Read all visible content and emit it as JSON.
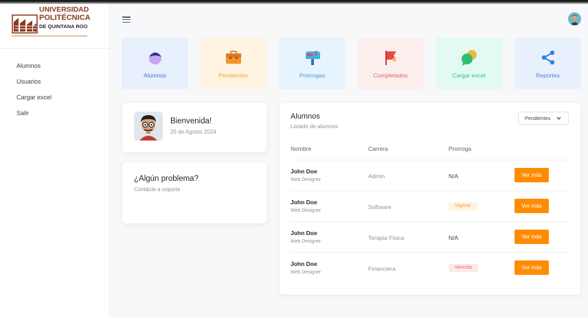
{
  "logo": {
    "line1": "UNIVERSIDAD",
    "line2": "POLITÉCNICA",
    "line3": "DE QUINTANA ROO"
  },
  "sidebar": {
    "items": [
      {
        "label": "Alumnos"
      },
      {
        "label": "Usuarios"
      },
      {
        "label": "Cargar excel"
      },
      {
        "label": "Salir"
      }
    ]
  },
  "cards": [
    {
      "label": "Alumnos",
      "bg": "#e8effd",
      "color": "#4a73d9",
      "icon": "student-icon"
    },
    {
      "label": "Pendientes",
      "bg": "#fff4e2",
      "color": "#f0a030",
      "icon": "briefcase-icon"
    },
    {
      "label": "Prorrogas",
      "bg": "#e7f3fd",
      "color": "#4a9ad9",
      "icon": "mailbox-icon"
    },
    {
      "label": "Completados",
      "bg": "#fdeeee",
      "color": "#e0605e",
      "icon": "flag-icon"
    },
    {
      "label": "Cargar excel",
      "bg": "#e3faf4",
      "color": "#2fbf93",
      "icon": "chat-bubbles-icon"
    },
    {
      "label": "Reportes",
      "bg": "#e9f0fd",
      "color": "#4a82d9",
      "icon": "share-icon"
    }
  ],
  "welcome": {
    "title": "Bienvenida!",
    "date": "25 de Agosto 2024"
  },
  "problem": {
    "title": "¿Algún problema?",
    "subtitle": "Contácte a soporte"
  },
  "table": {
    "title": "Alumnos",
    "subtitle": "Listado de alumnos",
    "filter": "Pendientes",
    "columns": [
      "Nombre",
      "Carrera",
      "Prorroga"
    ],
    "rows": [
      {
        "name": "John Doe",
        "role": "Web Designer",
        "carrera": "Admin",
        "prorroga": "N/A",
        "badge": "",
        "button": "Ver más"
      },
      {
        "name": "John Doe",
        "role": "Web Designer",
        "carrera": "Software",
        "prorroga": "Vigente",
        "badge": "vigente",
        "button": "Ver más"
      },
      {
        "name": "John Doe",
        "role": "Web Designer",
        "carrera": "Terapia Fisica",
        "prorroga": "N/A",
        "badge": "",
        "button": "Ver más"
      },
      {
        "name": "John Doe",
        "role": "Web Designer",
        "carrera": "Financiera",
        "prorroga": "Vencida",
        "badge": "vencida",
        "button": "Ver más"
      }
    ]
  }
}
